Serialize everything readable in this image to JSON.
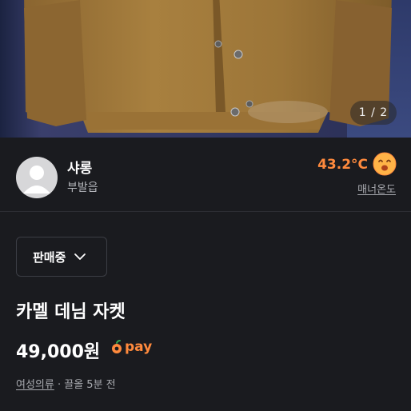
{
  "photo": {
    "page_indicator": "1 / 2"
  },
  "seller": {
    "name": "샤롱",
    "location": "부발읍",
    "temperature": "43.2°C",
    "manner_label": "매너온도"
  },
  "status": {
    "label": "판매중"
  },
  "product": {
    "title": "카멜 데님 자켓",
    "price": "49,000원",
    "pay_label": "pay",
    "category": "여성의류",
    "separator": " · ",
    "bump_time": "끌올 5분 전"
  },
  "colors": {
    "background": "#1a1b1f",
    "accent": "#ff8a3d",
    "jacket": "#a27b3c"
  },
  "icons": [
    "avatar-placeholder",
    "smile-face-icon",
    "chevron-down-icon",
    "pay-logo-icon"
  ]
}
